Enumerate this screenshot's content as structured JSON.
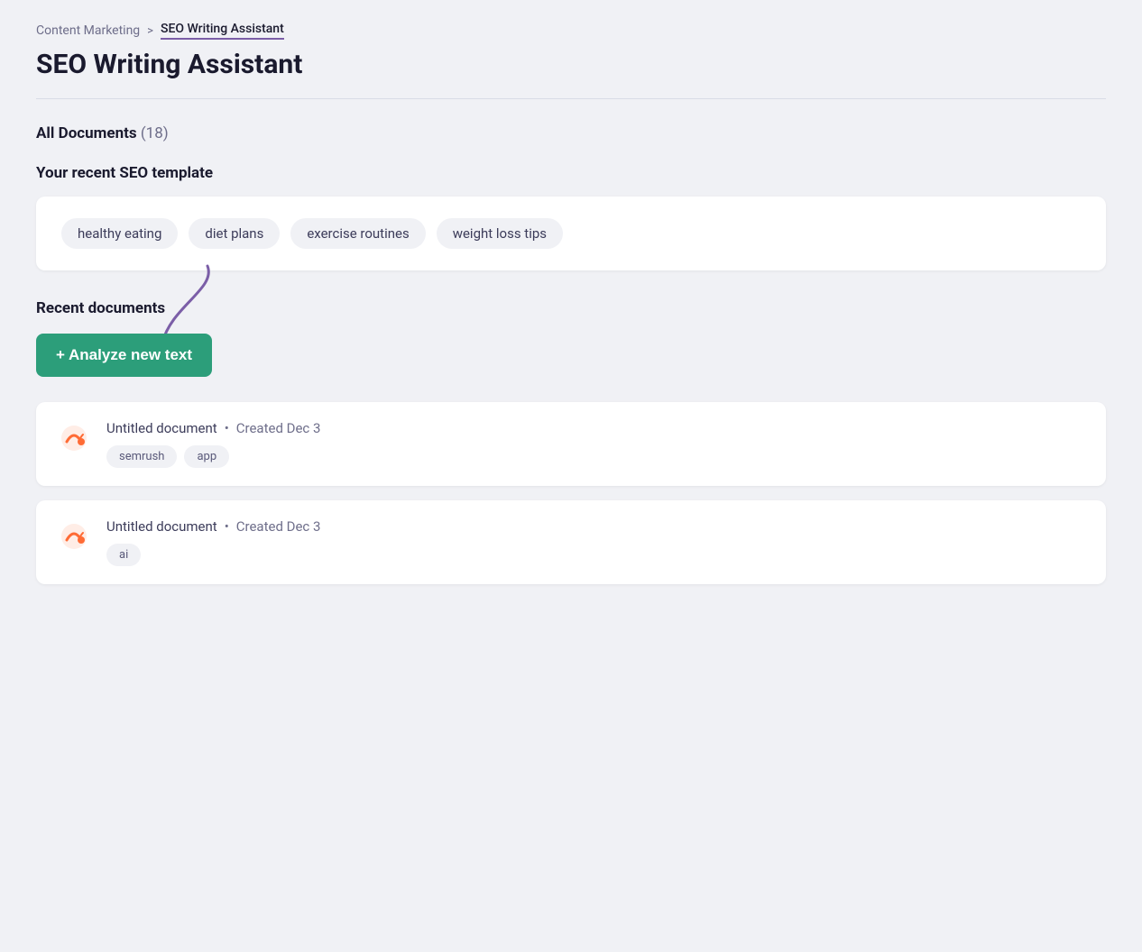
{
  "breadcrumb": {
    "parent": "Content Marketing",
    "separator": ">",
    "current": "SEO Writing Assistant"
  },
  "page_title": "SEO Writing Assistant",
  "all_documents": {
    "label": "All Documents",
    "count": "(18)"
  },
  "recent_template": {
    "label": "Your recent SEO template",
    "keywords": [
      "healthy eating",
      "diet plans",
      "exercise routines",
      "weight loss tips"
    ]
  },
  "recent_documents": {
    "label": "Recent documents",
    "analyze_button": "+ Analyze new text",
    "documents": [
      {
        "title": "Untitled document",
        "created": "Created Dec 3",
        "tags": [
          "semrush",
          "app"
        ]
      },
      {
        "title": "Untitled document",
        "created": "Created Dec 3",
        "tags": [
          "ai"
        ]
      }
    ]
  }
}
